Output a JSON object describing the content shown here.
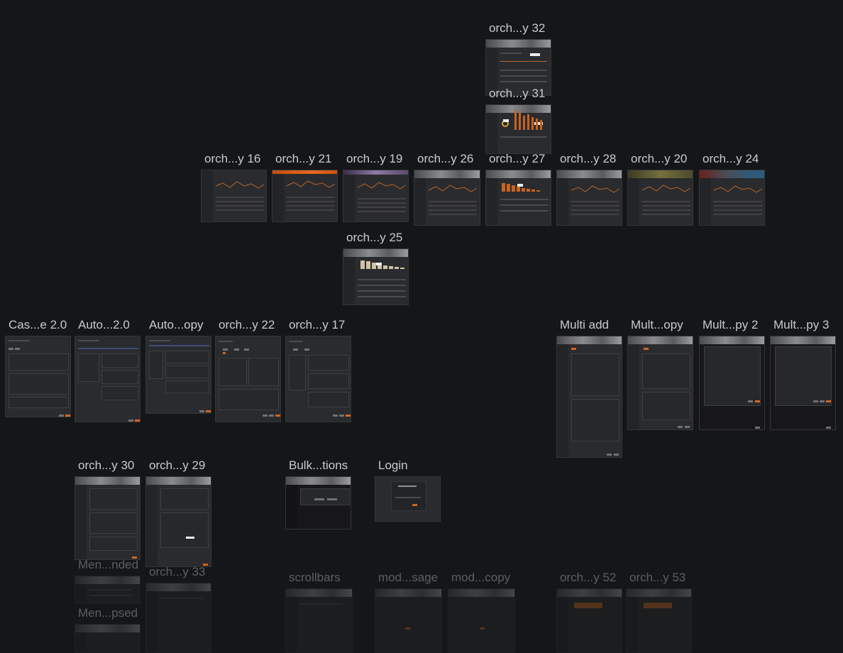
{
  "frames": [
    {
      "id": "f32",
      "label": "orch...y 32"
    },
    {
      "id": "f31",
      "label": "orch...y 31"
    },
    {
      "id": "f16",
      "label": "orch...y 16"
    },
    {
      "id": "f21",
      "label": "orch...y 21"
    },
    {
      "id": "f19",
      "label": "orch...y 19"
    },
    {
      "id": "f26",
      "label": "orch...y 26"
    },
    {
      "id": "f27",
      "label": "orch...y 27"
    },
    {
      "id": "f28",
      "label": "orch...y 28"
    },
    {
      "id": "f20",
      "label": "orch...y 20"
    },
    {
      "id": "f24",
      "label": "orch...y 24"
    },
    {
      "id": "f25",
      "label": "orch...y 25"
    },
    {
      "id": "cas20",
      "label": "Cas...e 2.0"
    },
    {
      "id": "auto20",
      "label": "Auto...2.0"
    },
    {
      "id": "autocopy",
      "label": "Auto...opy"
    },
    {
      "id": "f22",
      "label": "orch...y 22"
    },
    {
      "id": "f17",
      "label": "orch...y 17"
    },
    {
      "id": "multiadd",
      "label": "Multi add"
    },
    {
      "id": "multcopy",
      "label": "Mult...opy"
    },
    {
      "id": "multpy2",
      "label": "Mult...py 2"
    },
    {
      "id": "multpy3",
      "label": "Mult...py 3"
    },
    {
      "id": "f30",
      "label": "orch...y 30"
    },
    {
      "id": "f29",
      "label": "orch...y 29"
    },
    {
      "id": "bulk",
      "label": "Bulk...tions"
    },
    {
      "id": "login",
      "label": "Login"
    },
    {
      "id": "menexp",
      "label": "Men...nded"
    },
    {
      "id": "f33",
      "label": "orch...y 33"
    },
    {
      "id": "mencol",
      "label": "Men...psed"
    },
    {
      "id": "scroll",
      "label": "scrollbars"
    },
    {
      "id": "modsage",
      "label": "mod...sage"
    },
    {
      "id": "modcopy",
      "label": "mod...copy"
    },
    {
      "id": "f52",
      "label": "orch...y 52"
    },
    {
      "id": "f53",
      "label": "orch...y 53"
    }
  ],
  "colors": {
    "canvas_bg": "#151618",
    "label": "#c9cacc",
    "label_dim": "#5c5e62",
    "accent": "#d2661c"
  }
}
